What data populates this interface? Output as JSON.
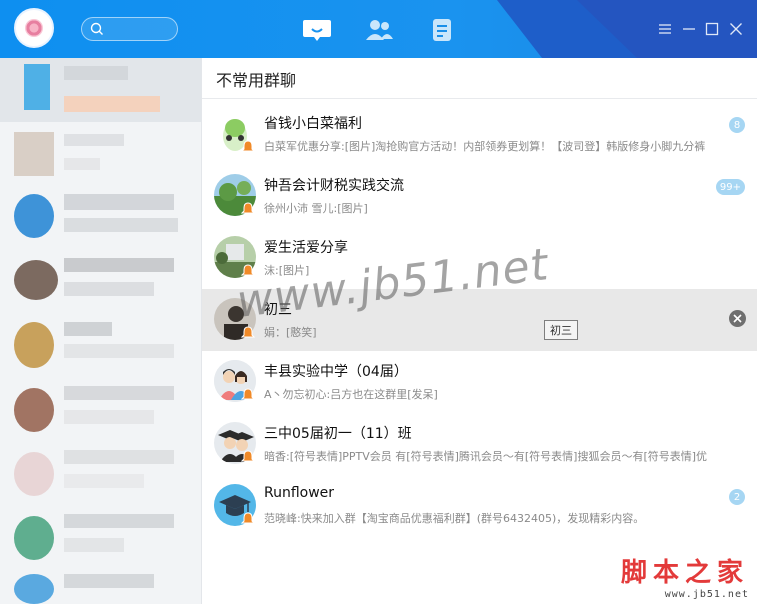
{
  "window": {
    "nav_tabs": [
      {
        "icon": "chat-bubble-icon",
        "active": true
      },
      {
        "icon": "contacts-icon",
        "active": false
      },
      {
        "icon": "notes-icon",
        "active": false
      }
    ],
    "controls": [
      "menu-icon",
      "minimize-icon",
      "maximize-icon",
      "close-icon"
    ]
  },
  "section": {
    "title": "不常用群聊"
  },
  "groups": [
    {
      "name": "省钱小白菜福利",
      "message": "白菜军优惠分享:[图片]淘抢购官方活动！内部领券更划算！【波司登】韩版修身小脚九分裤",
      "badge": "8",
      "muted": true
    },
    {
      "name": "钟吾会计财税实践交流",
      "message": "徐州小沛   雪儿:[图片]",
      "badge": "99+",
      "muted": true
    },
    {
      "name": "爱生活爱分享",
      "message": "沫:[图片]",
      "badge": "",
      "muted": true
    },
    {
      "name": "初三",
      "message": "娟：[憨笑]",
      "badge": "",
      "muted": true,
      "tooltip": "初三"
    },
    {
      "name": "丰县实验中学（04届）",
      "message": "A丶勿忘初心:吕方也在这群里[发呆]",
      "badge": "",
      "muted": true
    },
    {
      "name": "三中05届初一（11）班",
      "message": "暗香:[符号表情]PPTV会员 有[符号表情]腾讯会员～有[符号表情]搜狐会员～有[符号表情]优",
      "badge": "",
      "muted": true
    },
    {
      "name": "Runflower",
      "message": "范晓峰:快来加入群【淘宝商品优惠福利群】(群号6432405)，发现精彩内容。",
      "badge": "2",
      "muted": true
    }
  ],
  "watermark": "www.jb51.net",
  "corner_logo": {
    "chinese": "脚本之家",
    "url": "www.jb51.net"
  },
  "colors": {
    "titlebar": "#1a93ef",
    "badge": "#a6d6f3",
    "selected_row": "#e8e8e8"
  }
}
